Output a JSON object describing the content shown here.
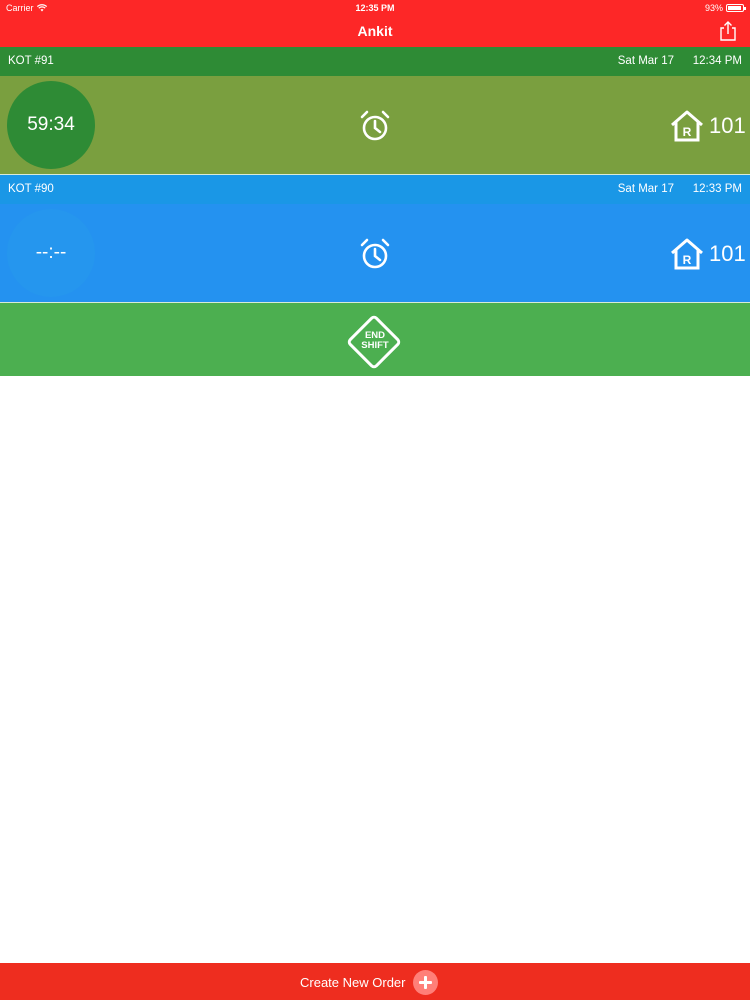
{
  "status_bar": {
    "carrier": "Carrier",
    "time": "12:35 PM",
    "battery": "93%"
  },
  "nav": {
    "title": "Ankit",
    "share_icon": "share-icon"
  },
  "orders": [
    {
      "kot": "KOT #91",
      "date": "Sat Mar 17",
      "time": "12:34 PM",
      "timer": "59:34",
      "room": "101",
      "header_color": "#2e8b35",
      "body_color": "#7a9f3f"
    },
    {
      "kot": "KOT #90",
      "date": "Sat Mar 17",
      "time": "12:33 PM",
      "timer": "--:--",
      "room": "101",
      "header_color": "#1a97e6",
      "body_color": "#2492f0"
    }
  ],
  "end_shift": {
    "line1": "END",
    "line2": "SHIFT",
    "color": "#4caf50"
  },
  "bottom": {
    "create_label": "Create New Order",
    "icon": "plus-icon",
    "color": "#ee2d1f"
  },
  "colors": {
    "top_bar": "#fd2727"
  }
}
